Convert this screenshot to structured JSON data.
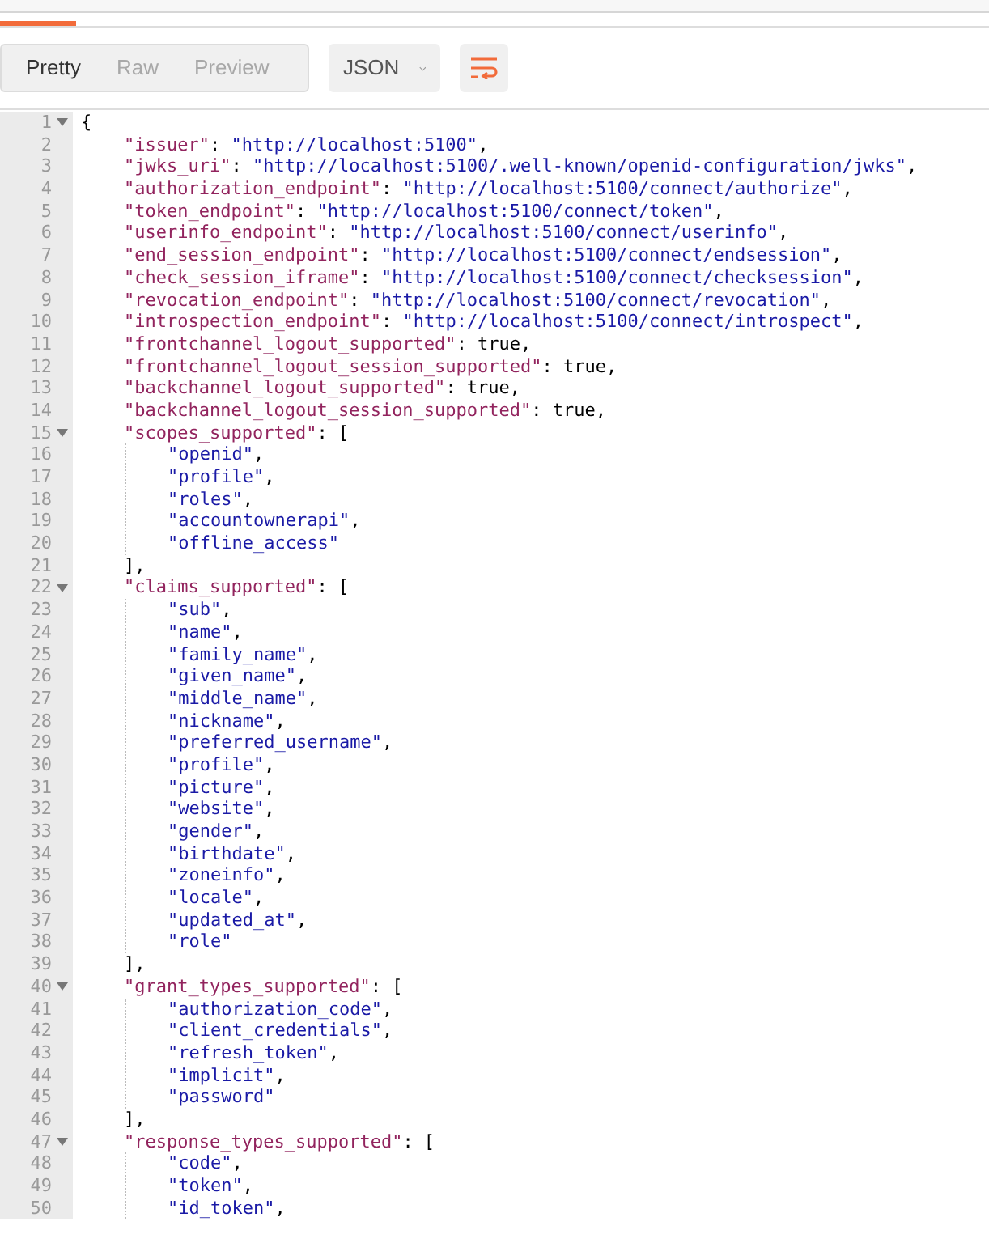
{
  "view_tabs": [
    {
      "label": "Pretty",
      "selected": true
    },
    {
      "label": "Raw",
      "selected": false
    },
    {
      "label": "Preview",
      "selected": false
    }
  ],
  "format_dropdown": {
    "value": "JSON"
  },
  "editor": {
    "lines": [
      {
        "number": "1",
        "parts": [
          {
            "kind": "punct",
            "text": "{"
          }
        ],
        "expanded": true,
        "children": [
          {
            "number": "2",
            "parts": [
              {
                "kind": "key",
                "text": "\"issuer\""
              },
              {
                "kind": "punct",
                "text": ": "
              },
              {
                "kind": "string",
                "text": "\"http://localhost:5100\""
              },
              {
                "kind": "punct",
                "text": ","
              }
            ]
          },
          {
            "number": "3",
            "parts": [
              {
                "kind": "key",
                "text": "\"jwks_uri\""
              },
              {
                "kind": "punct",
                "text": ": "
              },
              {
                "kind": "string",
                "text": "\"http://localhost:5100/.well-known/openid-configuration/jwks\""
              },
              {
                "kind": "punct",
                "text": ","
              }
            ]
          },
          {
            "number": "4",
            "parts": [
              {
                "kind": "key",
                "text": "\"authorization_endpoint\""
              },
              {
                "kind": "punct",
                "text": ": "
              },
              {
                "kind": "string",
                "text": "\"http://localhost:5100/connect/authorize\""
              },
              {
                "kind": "punct",
                "text": ","
              }
            ]
          },
          {
            "number": "5",
            "parts": [
              {
                "kind": "key",
                "text": "\"token_endpoint\""
              },
              {
                "kind": "punct",
                "text": ": "
              },
              {
                "kind": "string",
                "text": "\"http://localhost:5100/connect/token\""
              },
              {
                "kind": "punct",
                "text": ","
              }
            ]
          },
          {
            "number": "6",
            "parts": [
              {
                "kind": "key",
                "text": "\"userinfo_endpoint\""
              },
              {
                "kind": "punct",
                "text": ": "
              },
              {
                "kind": "string",
                "text": "\"http://localhost:5100/connect/userinfo\""
              },
              {
                "kind": "punct",
                "text": ","
              }
            ]
          },
          {
            "number": "7",
            "parts": [
              {
                "kind": "key",
                "text": "\"end_session_endpoint\""
              },
              {
                "kind": "punct",
                "text": ": "
              },
              {
                "kind": "string",
                "text": "\"http://localhost:5100/connect/endsession\""
              },
              {
                "kind": "punct",
                "text": ","
              }
            ]
          },
          {
            "number": "8",
            "parts": [
              {
                "kind": "key",
                "text": "\"check_session_iframe\""
              },
              {
                "kind": "punct",
                "text": ": "
              },
              {
                "kind": "string",
                "text": "\"http://localhost:5100/connect/checksession\""
              },
              {
                "kind": "punct",
                "text": ","
              }
            ]
          },
          {
            "number": "9",
            "parts": [
              {
                "kind": "key",
                "text": "\"revocation_endpoint\""
              },
              {
                "kind": "punct",
                "text": ": "
              },
              {
                "kind": "string",
                "text": "\"http://localhost:5100/connect/revocation\""
              },
              {
                "kind": "punct",
                "text": ","
              }
            ]
          },
          {
            "number": "10",
            "parts": [
              {
                "kind": "key",
                "text": "\"introspection_endpoint\""
              },
              {
                "kind": "punct",
                "text": ": "
              },
              {
                "kind": "string",
                "text": "\"http://localhost:5100/connect/introspect\""
              },
              {
                "kind": "punct",
                "text": ","
              }
            ]
          },
          {
            "number": "11",
            "parts": [
              {
                "kind": "key",
                "text": "\"frontchannel_logout_supported\""
              },
              {
                "kind": "punct",
                "text": ": true,"
              }
            ]
          },
          {
            "number": "12",
            "parts": [
              {
                "kind": "key",
                "text": "\"frontchannel_logout_session_supported\""
              },
              {
                "kind": "punct",
                "text": ": true,"
              }
            ]
          },
          {
            "number": "13",
            "parts": [
              {
                "kind": "key",
                "text": "\"backchannel_logout_supported\""
              },
              {
                "kind": "punct",
                "text": ": true,"
              }
            ]
          },
          {
            "number": "14",
            "parts": [
              {
                "kind": "key",
                "text": "\"backchannel_logout_session_supported\""
              },
              {
                "kind": "punct",
                "text": ": true,"
              }
            ]
          },
          {
            "number": "15",
            "parts": [
              {
                "kind": "key",
                "text": "\"scopes_supported\""
              },
              {
                "kind": "punct",
                "text": ": ["
              }
            ],
            "expanded": true,
            "children": [
              {
                "number": "16",
                "parts": [
                  {
                    "kind": "string",
                    "text": "\"openid\""
                  },
                  {
                    "kind": "punct",
                    "text": ","
                  }
                ]
              },
              {
                "number": "17",
                "parts": [
                  {
                    "kind": "string",
                    "text": "\"profile\""
                  },
                  {
                    "kind": "punct",
                    "text": ","
                  }
                ]
              },
              {
                "number": "18",
                "parts": [
                  {
                    "kind": "string",
                    "text": "\"roles\""
                  },
                  {
                    "kind": "punct",
                    "text": ","
                  }
                ]
              },
              {
                "number": "19",
                "parts": [
                  {
                    "kind": "string",
                    "text": "\"accountownerapi\""
                  },
                  {
                    "kind": "punct",
                    "text": ","
                  }
                ]
              },
              {
                "number": "20",
                "parts": [
                  {
                    "kind": "string",
                    "text": "\"offline_access\""
                  }
                ]
              }
            ]
          },
          {
            "number": "21",
            "parts": [
              {
                "kind": "punct",
                "text": "],"
              }
            ]
          },
          {
            "number": "22",
            "parts": [
              {
                "kind": "key",
                "text": "\"claims_supported\""
              },
              {
                "kind": "punct",
                "text": ": ["
              }
            ],
            "expanded": true,
            "children": [
              {
                "number": "23",
                "parts": [
                  {
                    "kind": "string",
                    "text": "\"sub\""
                  },
                  {
                    "kind": "punct",
                    "text": ","
                  }
                ]
              },
              {
                "number": "24",
                "parts": [
                  {
                    "kind": "string",
                    "text": "\"name\""
                  },
                  {
                    "kind": "punct",
                    "text": ","
                  }
                ]
              },
              {
                "number": "25",
                "parts": [
                  {
                    "kind": "string",
                    "text": "\"family_name\""
                  },
                  {
                    "kind": "punct",
                    "text": ","
                  }
                ]
              },
              {
                "number": "26",
                "parts": [
                  {
                    "kind": "string",
                    "text": "\"given_name\""
                  },
                  {
                    "kind": "punct",
                    "text": ","
                  }
                ]
              },
              {
                "number": "27",
                "parts": [
                  {
                    "kind": "string",
                    "text": "\"middle_name\""
                  },
                  {
                    "kind": "punct",
                    "text": ","
                  }
                ]
              },
              {
                "number": "28",
                "parts": [
                  {
                    "kind": "string",
                    "text": "\"nickname\""
                  },
                  {
                    "kind": "punct",
                    "text": ","
                  }
                ]
              },
              {
                "number": "29",
                "parts": [
                  {
                    "kind": "string",
                    "text": "\"preferred_username\""
                  },
                  {
                    "kind": "punct",
                    "text": ","
                  }
                ]
              },
              {
                "number": "30",
                "parts": [
                  {
                    "kind": "string",
                    "text": "\"profile\""
                  },
                  {
                    "kind": "punct",
                    "text": ","
                  }
                ]
              },
              {
                "number": "31",
                "parts": [
                  {
                    "kind": "string",
                    "text": "\"picture\""
                  },
                  {
                    "kind": "punct",
                    "text": ","
                  }
                ]
              },
              {
                "number": "32",
                "parts": [
                  {
                    "kind": "string",
                    "text": "\"website\""
                  },
                  {
                    "kind": "punct",
                    "text": ","
                  }
                ]
              },
              {
                "number": "33",
                "parts": [
                  {
                    "kind": "string",
                    "text": "\"gender\""
                  },
                  {
                    "kind": "punct",
                    "text": ","
                  }
                ]
              },
              {
                "number": "34",
                "parts": [
                  {
                    "kind": "string",
                    "text": "\"birthdate\""
                  },
                  {
                    "kind": "punct",
                    "text": ","
                  }
                ]
              },
              {
                "number": "35",
                "parts": [
                  {
                    "kind": "string",
                    "text": "\"zoneinfo\""
                  },
                  {
                    "kind": "punct",
                    "text": ","
                  }
                ]
              },
              {
                "number": "36",
                "parts": [
                  {
                    "kind": "string",
                    "text": "\"locale\""
                  },
                  {
                    "kind": "punct",
                    "text": ","
                  }
                ]
              },
              {
                "number": "37",
                "parts": [
                  {
                    "kind": "string",
                    "text": "\"updated_at\""
                  },
                  {
                    "kind": "punct",
                    "text": ","
                  }
                ]
              },
              {
                "number": "38",
                "parts": [
                  {
                    "kind": "string",
                    "text": "\"role\""
                  }
                ]
              }
            ]
          },
          {
            "number": "39",
            "parts": [
              {
                "kind": "punct",
                "text": "],"
              }
            ]
          },
          {
            "number": "40",
            "parts": [
              {
                "kind": "key",
                "text": "\"grant_types_supported\""
              },
              {
                "kind": "punct",
                "text": ": ["
              }
            ],
            "expanded": true,
            "children": [
              {
                "number": "41",
                "parts": [
                  {
                    "kind": "string",
                    "text": "\"authorization_code\""
                  },
                  {
                    "kind": "punct",
                    "text": ","
                  }
                ]
              },
              {
                "number": "42",
                "parts": [
                  {
                    "kind": "string",
                    "text": "\"client_credentials\""
                  },
                  {
                    "kind": "punct",
                    "text": ","
                  }
                ]
              },
              {
                "number": "43",
                "parts": [
                  {
                    "kind": "string",
                    "text": "\"refresh_token\""
                  },
                  {
                    "kind": "punct",
                    "text": ","
                  }
                ]
              },
              {
                "number": "44",
                "parts": [
                  {
                    "kind": "string",
                    "text": "\"implicit\""
                  },
                  {
                    "kind": "punct",
                    "text": ","
                  }
                ]
              },
              {
                "number": "45",
                "parts": [
                  {
                    "kind": "string",
                    "text": "\"password\""
                  }
                ]
              }
            ]
          },
          {
            "number": "46",
            "parts": [
              {
                "kind": "punct",
                "text": "],"
              }
            ]
          },
          {
            "number": "47",
            "parts": [
              {
                "kind": "key",
                "text": "\"response_types_supported\""
              },
              {
                "kind": "punct",
                "text": ": ["
              }
            ],
            "expanded": true,
            "children": [
              {
                "number": "48",
                "parts": [
                  {
                    "kind": "string",
                    "text": "\"code\""
                  },
                  {
                    "kind": "punct",
                    "text": ","
                  }
                ]
              },
              {
                "number": "49",
                "parts": [
                  {
                    "kind": "string",
                    "text": "\"token\""
                  },
                  {
                    "kind": "punct",
                    "text": ","
                  }
                ]
              },
              {
                "number": "50",
                "parts": [
                  {
                    "kind": "string",
                    "text": "\"id_token\""
                  },
                  {
                    "kind": "punct",
                    "text": ","
                  }
                ]
              }
            ]
          }
        ]
      }
    ]
  }
}
